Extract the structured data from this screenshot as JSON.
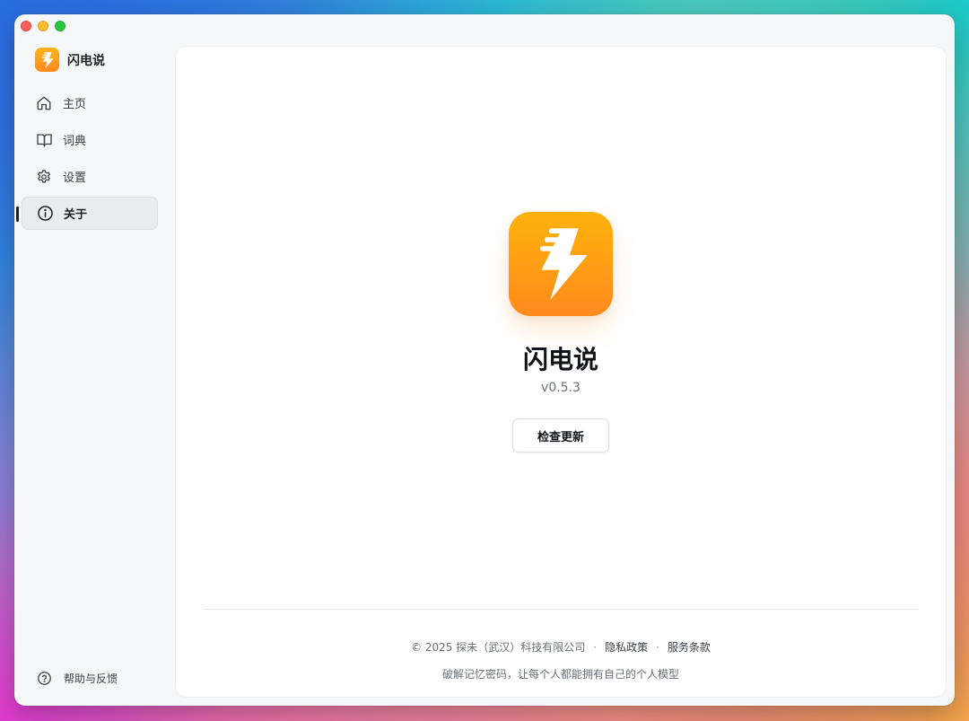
{
  "app": {
    "name": "闪电说",
    "brand_color": "#ff9a1a"
  },
  "sidebar": {
    "items": [
      {
        "label": "主页",
        "icon": "home-icon"
      },
      {
        "label": "词典",
        "icon": "book-icon"
      },
      {
        "label": "设置",
        "icon": "gear-icon"
      },
      {
        "label": "关于",
        "icon": "info-icon",
        "active": true
      }
    ],
    "help_label": "帮助与反馈"
  },
  "about": {
    "title": "闪电说",
    "version": "v0.5.3",
    "check_update_label": "检查更新"
  },
  "footer": {
    "copyright": "© 2025 探未（武汉）科技有限公司",
    "separator": "·",
    "privacy_label": "隐私政策",
    "terms_label": "服务条款",
    "tagline": "破解记忆密码，让每个人都能拥有自己的个人模型"
  }
}
